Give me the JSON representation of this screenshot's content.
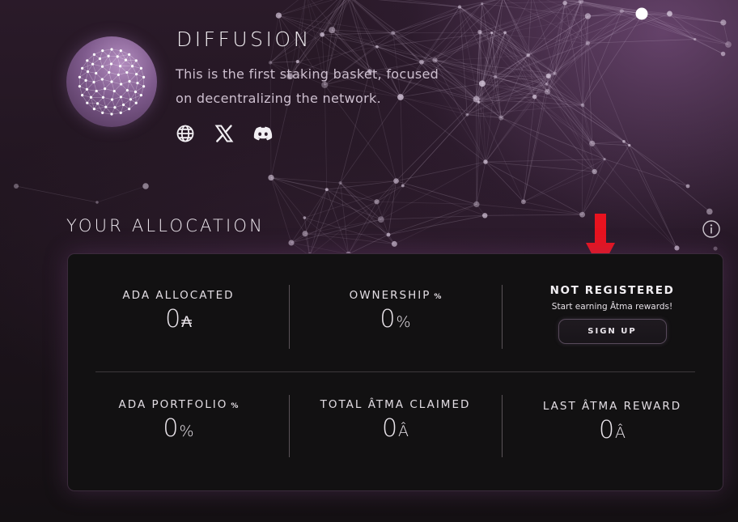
{
  "header": {
    "title": "DIFFUSION",
    "description_line1": "This is the first staking basket, focused",
    "description_line2": "on decentralizing the network.",
    "logo_icon": "diffusion-network-logo",
    "social": [
      {
        "icon": "globe-icon"
      },
      {
        "icon": "x-icon"
      },
      {
        "icon": "discord-icon"
      }
    ]
  },
  "allocation": {
    "title": "YOUR ALLOCATION",
    "info_icon": "info-icon",
    "annotation_icon": "red-arrow-down-icon",
    "ada_allocated": {
      "label": "ADA ALLOCATED",
      "value": "0",
      "unit": "₳"
    },
    "ownership": {
      "label": "OWNERSHIP",
      "suffix": "%",
      "value": "0",
      "unit": "%"
    },
    "registration": {
      "status": "NOT REGISTERED",
      "subtitle": "Start earning Âtma rewards!",
      "button_label": "SIGN UP"
    },
    "ada_portfolio": {
      "label": "ADA PORTFOLIO",
      "suffix": "%",
      "value": "0",
      "unit": "%"
    },
    "total_atma_claimed": {
      "label": "TOTAL ÂTMA CLAIMED",
      "value": "0",
      "unit": "Â"
    },
    "last_atma_reward": {
      "label": "LAST ÂTMA REWARD",
      "value": "0",
      "unit": "Â"
    }
  },
  "colors": {
    "accent": "#8e6a9a",
    "arrow": "#e8131f",
    "card_bg": "#121112"
  }
}
